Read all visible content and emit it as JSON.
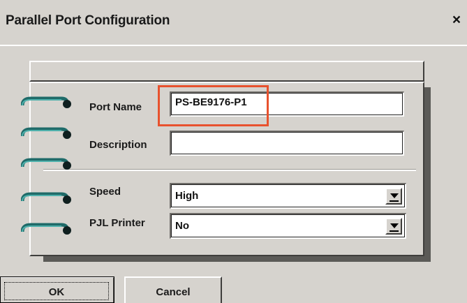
{
  "window": {
    "title": "Parallel Port Configuration",
    "close_glyph": "×"
  },
  "form": {
    "port_name_label": "Port Name",
    "port_name_value": "PS-BE9176-P1",
    "description_label": "Description",
    "description_value": "",
    "speed_label": "Speed",
    "speed_value": "High",
    "pjl_label": "PJL Printer",
    "pjl_value": "No"
  },
  "buttons": {
    "ok": "OK",
    "cancel": "Cancel"
  },
  "icons": [
    "close-icon",
    "binder-ring-icon",
    "dropdown-arrow-icon"
  ],
  "colors": {
    "background": "#d6d3ce",
    "highlight": "#e8522e",
    "ring": "#2e7f7c"
  }
}
